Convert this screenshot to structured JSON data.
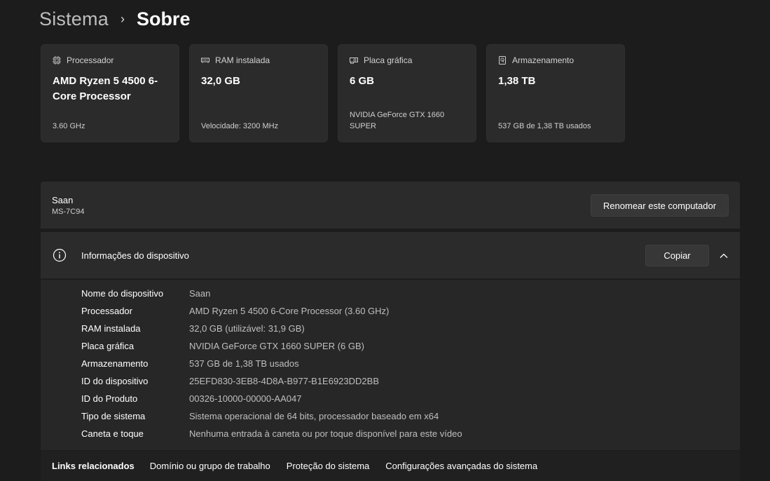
{
  "breadcrumb": {
    "parent": "Sistema",
    "separator": "›",
    "current": "Sobre"
  },
  "cards": [
    {
      "icon": "processor-icon",
      "label": "Processador",
      "value": "AMD Ryzen 5 4500 6-Core Processor",
      "detail": "3.60 GHz"
    },
    {
      "icon": "ram-icon",
      "label": "RAM instalada",
      "value": "32,0 GB",
      "detail": "Velocidade: 3200 MHz"
    },
    {
      "icon": "graphics-card-icon",
      "label": "Placa gráfica",
      "value": "6 GB",
      "detail": "NVIDIA GeForce GTX 1660 SUPER"
    },
    {
      "icon": "storage-icon",
      "label": "Armazenamento",
      "value": "1,38 TB",
      "detail": "537 GB de 1,38 TB usados"
    }
  ],
  "computer": {
    "name": "Saan",
    "model": "MS-7C94",
    "rename_label": "Renomear este computador"
  },
  "device_info": {
    "title": "Informações do dispositivo",
    "copy_label": "Copiar",
    "rows": [
      {
        "key": "Nome do dispositivo",
        "value": "Saan"
      },
      {
        "key": "Processador",
        "value": "AMD Ryzen 5 4500 6-Core Processor (3.60 GHz)"
      },
      {
        "key": "RAM instalada",
        "value": "32,0 GB (utilizável: 31,9 GB)"
      },
      {
        "key": "Placa gráfica",
        "value": "NVIDIA GeForce GTX 1660 SUPER (6 GB)"
      },
      {
        "key": "Armazenamento",
        "value": "537 GB de 1,38 TB usados"
      },
      {
        "key": "ID do dispositivo",
        "value": "25EFD830-3EB8-4D8A-B977-B1E6923DD2BB"
      },
      {
        "key": "ID do Produto",
        "value": "00326-10000-00000-AA047"
      },
      {
        "key": "Tipo de sistema",
        "value": "Sistema operacional de 64 bits, processador baseado em x64"
      },
      {
        "key": "Caneta e toque",
        "value": "Nenhuma entrada à caneta ou por toque disponível para este vídeo"
      }
    ]
  },
  "related_links": {
    "title": "Links relacionados",
    "links": [
      "Domínio ou grupo de trabalho",
      "Proteção do sistema",
      "Configurações avançadas do sistema"
    ]
  },
  "colors": {
    "background": "#1c1c1c",
    "card": "#2b2b2b",
    "button": "#373737",
    "muted_text": "#bfbfbf"
  }
}
